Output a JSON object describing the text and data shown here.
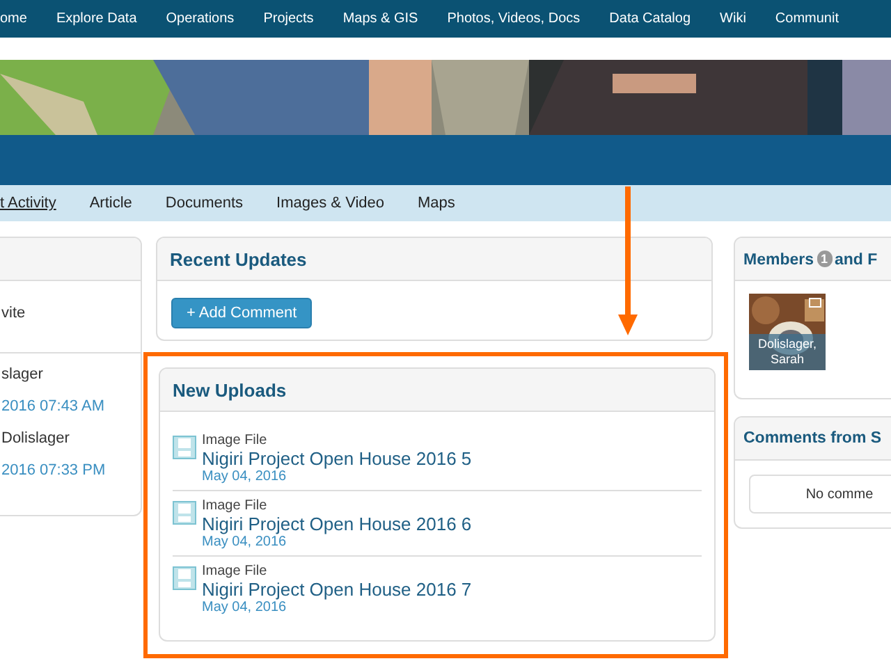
{
  "nav": [
    "ome",
    "Explore Data",
    "Operations",
    "Projects",
    "Maps & GIS",
    "Photos, Videos, Docs",
    "Data Catalog",
    "Wiki",
    "Communit"
  ],
  "subtabs": [
    {
      "label": "t Activity",
      "selected": true
    },
    {
      "label": "Article",
      "selected": false
    },
    {
      "label": "Documents",
      "selected": false
    },
    {
      "label": "Images & Video",
      "selected": false
    },
    {
      "label": "Maps",
      "selected": false
    }
  ],
  "left_card": {
    "top": "vite",
    "entries": [
      {
        "name": "slager",
        "time": "2016 07:43 AM"
      },
      {
        "name": "Dolislager",
        "time": "2016 07:33 PM"
      }
    ]
  },
  "recent_updates": {
    "title": "Recent Updates",
    "button": "+ Add Comment"
  },
  "new_uploads": {
    "title": "New Uploads",
    "highlighted": true,
    "items": [
      {
        "type": "Image File",
        "title": "Nigiri Project Open House 2016 5",
        "date": "May 04, 2016"
      },
      {
        "type": "Image File",
        "title": "Nigiri Project Open House 2016 6",
        "date": "May 04, 2016"
      },
      {
        "type": "Image File",
        "title": "Nigiri Project Open House 2016 7",
        "date": "May 04, 2016"
      }
    ]
  },
  "members": {
    "title": "Members",
    "count": "1",
    "title_rest": "and F",
    "people": [
      {
        "name": "Dolislager, Sarah"
      }
    ]
  },
  "comments": {
    "title": "Comments from S",
    "empty": "No comme"
  }
}
